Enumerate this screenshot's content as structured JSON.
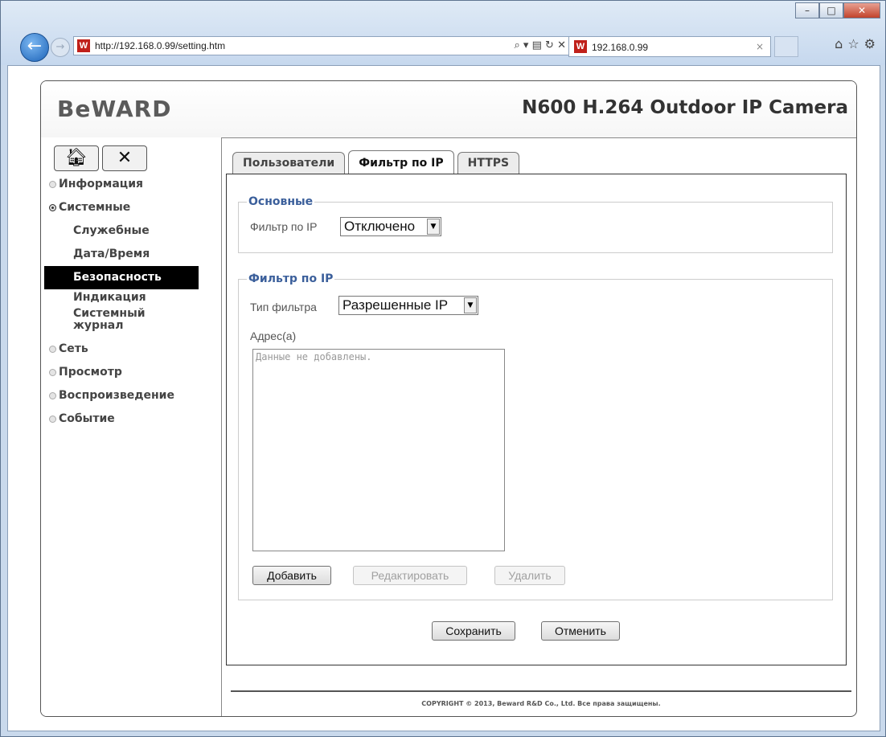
{
  "browser": {
    "url_host": "http://192.168.0.99",
    "url_path": "/setting.htm",
    "tab_title": "192.168.0.99",
    "favicon_text": "W"
  },
  "header": {
    "logo": "BeWARD",
    "model": "N600 H.264 Outdoor IP Camera"
  },
  "sidebar": {
    "menu": [
      {
        "label": "Информация",
        "expanded": false
      },
      {
        "label": "Системные",
        "expanded": true
      },
      {
        "label": "Сеть",
        "expanded": false
      },
      {
        "label": "Просмотр",
        "expanded": false
      },
      {
        "label": "Воспроизведение",
        "expanded": false
      },
      {
        "label": "Событие",
        "expanded": false
      }
    ],
    "system_sub": [
      "Служебные",
      "Дата/Время",
      "Безопасность",
      "Индикация",
      "Системный журнал"
    ],
    "active_sub": "Безопасность"
  },
  "tabs": [
    "Пользователи",
    "Фильтр по IP",
    "HTTPS"
  ],
  "active_tab": "Фильтр по IP",
  "basic": {
    "legend": "Основные",
    "filter_label": "Фильтр по IP",
    "filter_value": "Отключено"
  },
  "ipfilter": {
    "legend": "Фильтр по IP",
    "type_label": "Тип фильтра",
    "type_value": "Разрешенные IP",
    "address_label": "Адрес(а)",
    "address_placeholder": "Данные не добавлены.",
    "add_label": "Добавить",
    "edit_label": "Редактировать",
    "delete_label": "Удалить"
  },
  "actions": {
    "save_label": "Сохранить",
    "cancel_label": "Отменить"
  },
  "footer": {
    "copyright": "COPYRIGHT © 2013, Beward R&D Co., Ltd. Все права защищены."
  }
}
